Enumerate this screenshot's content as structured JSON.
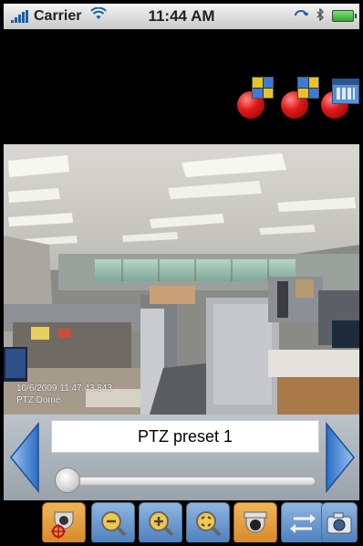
{
  "status_bar": {
    "carrier": "Carrier",
    "time": "11:44 AM"
  },
  "camera": {
    "timestamp": "10/6/2009 11:47:43.843",
    "camera_name": "PTZ Dome"
  },
  "controls": {
    "preset_label": "PTZ preset 1",
    "slider_value": 0.0
  },
  "toolbar": {
    "buttons": [
      {
        "icon": "ptz-target-icon",
        "state": "active"
      },
      {
        "icon": "zoom-out-icon",
        "state": "normal"
      },
      {
        "icon": "zoom-in-icon",
        "state": "normal"
      },
      {
        "icon": "zoom-fit-icon",
        "state": "normal"
      },
      {
        "icon": "dome-camera-icon",
        "state": "active"
      },
      {
        "icon": "swap-icon",
        "state": "normal"
      },
      {
        "icon": "snapshot-camera-icon",
        "state": "normal"
      }
    ]
  },
  "colors": {
    "accent_orange": "#E69A3C",
    "accent_blue": "#4D7FBD",
    "record_red": "#E01B1B",
    "panel_gray": "#ABB3BA"
  }
}
